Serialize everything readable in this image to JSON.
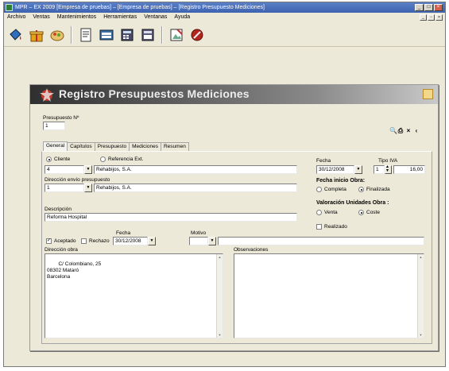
{
  "window": {
    "title": "MPR – EX 2009 [Empresa de pruebas] – [Empresa de pruebas] – [Registro Presupuesto Mediciones]"
  },
  "menu": {
    "items": [
      "Archivo",
      "Ventas",
      "Mantenimientos",
      "Herramientas",
      "Ventanas",
      "Ayuda"
    ]
  },
  "toolbar": {
    "icons": [
      "paint-bucket-icon",
      "gift-icon",
      "food-bowl-icon",
      "document-icon",
      "folder-stack-icon",
      "calculator-icon",
      "calculator-alt-icon",
      "image-edit-icon",
      "tools-icon"
    ]
  },
  "dialog": {
    "title": "Registro Presupuestos Mediciones",
    "budget_no_label": "Presupuesto Nº",
    "budget_no_value": "1",
    "tabs": [
      "General",
      "Capítulos",
      "Presupuesto",
      "Mediciones",
      "Resumen"
    ],
    "client_radio": "Cliente",
    "ref_radio": "Referencia Ext.",
    "client_code": "4",
    "client_name": "Rehabijos, S.A.",
    "address_label": "Dirección envío presupuesto",
    "address_code": "1",
    "address_name": "Rehabijos, S.A.",
    "description_label": "Descripción",
    "description_value": "Reforma Hospital",
    "accepted_label": "Aceptado",
    "rejected_label": "Rechazo",
    "date_label_small": "Fecha",
    "accepted_date": "30/12/2008",
    "reason_label": "Motivo",
    "work_address_label": "Dirección obra",
    "work_address_value": "C/ Colombiano, 25\n08302 Mataró\nBarcelona",
    "date_label": "Fecha",
    "date_value": "30/12/2008",
    "vat_label": "Tipo IVA",
    "vat_code": "1",
    "vat_rate": "16,00",
    "work_phase_label": "Fecha inicio Obra:",
    "complete_label": "Completa",
    "finished_label": "Finalizada",
    "valuation_label": "Valoración Unidades Obra :",
    "sale_label": "Venta",
    "cost_label": "Coste",
    "realized_label": "Realizado",
    "observations_label": "Observaciones"
  }
}
